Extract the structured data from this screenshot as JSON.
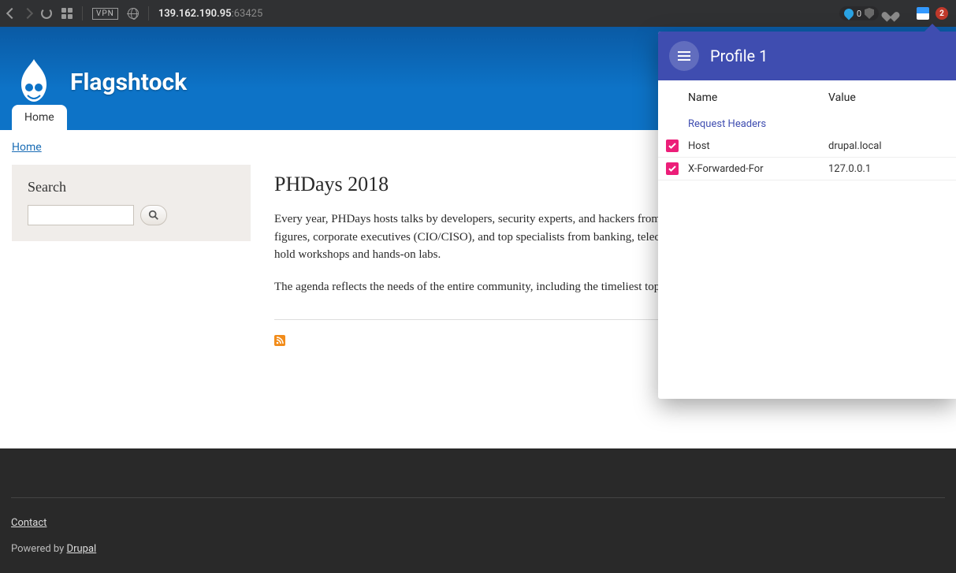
{
  "browser": {
    "vpn_label": "VPN",
    "address_ip": "139.162.190.95",
    "address_port": ":63425",
    "pill_count": "0",
    "badge_count": "2"
  },
  "site": {
    "name": "Flagshtock",
    "tab_home": "Home"
  },
  "breadcrumb": {
    "home": "Home"
  },
  "search": {
    "heading": "Search",
    "value": "",
    "placeholder": ""
  },
  "article": {
    "title": "PHDays 2018",
    "p1": "Every year, PHDays hosts talks by developers, security experts, and hackers from around the world. The forum brings together government figures, corporate executives (CIO/CISO), and top specialists from banking, telecom, oil/gas, and IT industries. Globally renowned experts hold workshops and hands-on labs.",
    "p2": "The agenda reflects the needs of the entire community, including the timeliest topics and latest trends."
  },
  "footer": {
    "contact": "Contact",
    "powered_prefix": "Powered by ",
    "powered_link": "Drupal"
  },
  "extension": {
    "title": "Profile 1",
    "col_name": "Name",
    "col_value": "Value",
    "section": "Request Headers",
    "rows": [
      {
        "name": "Host",
        "value": "drupal.local",
        "checked": true
      },
      {
        "name": "X-Forwarded-For",
        "value": "127.0.0.1",
        "checked": true
      }
    ]
  }
}
